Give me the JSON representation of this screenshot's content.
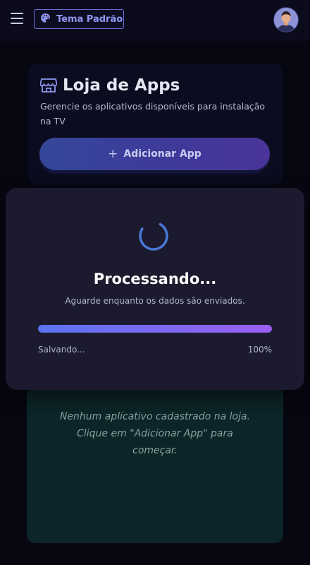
{
  "header": {
    "menu_icon": "hamburger-menu-icon",
    "theme_icon": "palette-icon",
    "theme_label": "Tema Padrão",
    "avatar_icon": "user-avatar"
  },
  "store": {
    "icon": "store-icon",
    "title": "Loja de Apps",
    "subtitle": "Gerencie os aplicativos disponíveis para instalação na TV",
    "add_icon": "+",
    "add_label": "Adicionar App"
  },
  "empty_state": {
    "line1": "Nenhum aplicativo cadastrado na loja.",
    "line2": "Clique em \"Adicionar App\" para começar."
  },
  "modal": {
    "spinner_icon": "loading-spinner-icon",
    "title": "Processando...",
    "subtitle": "Aguarde enquanto os dados são enviados.",
    "progress": 100,
    "status_text": "Salvando...",
    "percent_text": "100%"
  },
  "colors": {
    "background": "#070712",
    "accent": "#5b74f0",
    "accent_end": "#9b5ff2",
    "theme_border": "#6a6fd8",
    "empty_card": "#0c2528"
  }
}
